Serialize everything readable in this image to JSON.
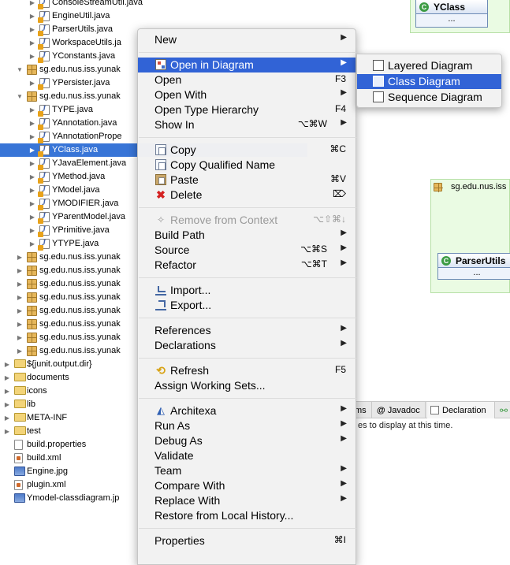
{
  "tree": {
    "rows": [
      {
        "label": "ConsoleStreamUtil.java",
        "kind": "java",
        "twisty": "right"
      },
      {
        "label": "EngineUtil.java",
        "kind": "java",
        "twisty": "right"
      },
      {
        "label": "ParserUtils.java",
        "kind": "java",
        "twisty": "right"
      },
      {
        "label": "WorkspaceUtils.ja",
        "kind": "java",
        "twisty": "right"
      },
      {
        "label": "YConstants.java",
        "kind": "java",
        "twisty": "right"
      },
      {
        "label": "sg.edu.nus.iss.yunak",
        "kind": "pkg",
        "twisty": "down"
      },
      {
        "label": "YPersister.java",
        "kind": "java",
        "twisty": "right"
      },
      {
        "label": "sg.edu.nus.iss.yunak",
        "kind": "pkg",
        "twisty": "down"
      },
      {
        "label": "TYPE.java",
        "kind": "java",
        "twisty": "right"
      },
      {
        "label": "YAnnotation.java",
        "kind": "java",
        "twisty": "right"
      },
      {
        "label": "YAnnotationPrope",
        "kind": "java",
        "twisty": "right"
      },
      {
        "label": "YClass.java",
        "kind": "java",
        "twisty": "right",
        "selected": true
      },
      {
        "label": "YJavaElement.java",
        "kind": "java",
        "twisty": "right"
      },
      {
        "label": "YMethod.java",
        "kind": "java",
        "twisty": "right"
      },
      {
        "label": "YModel.java",
        "kind": "java",
        "twisty": "right"
      },
      {
        "label": "YMODIFIER.java",
        "kind": "java",
        "twisty": "right"
      },
      {
        "label": "YParentModel.java",
        "kind": "java",
        "twisty": "right"
      },
      {
        "label": "YPrimitive.java",
        "kind": "java",
        "twisty": "right"
      },
      {
        "label": "YTYPE.java",
        "kind": "java",
        "twisty": "right"
      },
      {
        "label": "sg.edu.nus.iss.yunak",
        "kind": "pkg",
        "twisty": "right"
      },
      {
        "label": "sg.edu.nus.iss.yunak",
        "kind": "pkg",
        "twisty": "right"
      },
      {
        "label": "sg.edu.nus.iss.yunak",
        "kind": "pkg",
        "twisty": "right"
      },
      {
        "label": "sg.edu.nus.iss.yunak",
        "kind": "pkg",
        "twisty": "right"
      },
      {
        "label": "sg.edu.nus.iss.yunak",
        "kind": "pkg",
        "twisty": "right"
      },
      {
        "label": "sg.edu.nus.iss.yunak",
        "kind": "pkg",
        "twisty": "right"
      },
      {
        "label": "sg.edu.nus.iss.yunak",
        "kind": "pkg",
        "twisty": "right"
      },
      {
        "label": "sg.edu.nus.iss.yunak",
        "kind": "pkg",
        "twisty": "right"
      },
      {
        "label": "${junit.output.dir}",
        "kind": "folder",
        "twisty": "right"
      },
      {
        "label": "documents",
        "kind": "folder",
        "twisty": "right"
      },
      {
        "label": "icons",
        "kind": "folder",
        "twisty": "right"
      },
      {
        "label": "lib",
        "kind": "folder",
        "twisty": "right"
      },
      {
        "label": "META-INF",
        "kind": "folder",
        "twisty": "right"
      },
      {
        "label": "test",
        "kind": "folder",
        "twisty": "right"
      },
      {
        "label": "build.properties",
        "kind": "file",
        "twisty": "none"
      },
      {
        "label": "build.xml",
        "kind": "xml",
        "twisty": "none"
      },
      {
        "label": "Engine.jpg",
        "kind": "img",
        "twisty": "none"
      },
      {
        "label": "plugin.xml",
        "kind": "xml",
        "twisty": "none"
      },
      {
        "label": "Ymodel-classdiagram.jp",
        "kind": "img",
        "twisty": "none"
      }
    ]
  },
  "diagram": {
    "class_top": {
      "name": "YClass",
      "body": "..."
    },
    "package_label": "sg.edu.nus.iss",
    "class_bottom": {
      "name": "ParserUtils",
      "body": "..."
    }
  },
  "view_tabs": {
    "tabs": [
      {
        "label": "ms"
      },
      {
        "label": "Javadoc"
      },
      {
        "label": "Declaration"
      }
    ],
    "message": "es to display at this time."
  },
  "context_menu": {
    "items": [
      {
        "type": "item",
        "label": "New",
        "arrow": true
      },
      {
        "type": "sep"
      },
      {
        "type": "item",
        "label": "Open in Diagram",
        "arrow": true,
        "icon": "diagram-icon",
        "highlight": true
      },
      {
        "type": "item",
        "label": "Open",
        "shortcut": "F3"
      },
      {
        "type": "item",
        "label": "Open With",
        "arrow": true
      },
      {
        "type": "item",
        "label": "Open Type Hierarchy",
        "shortcut": "F4"
      },
      {
        "type": "item",
        "label": "Show In",
        "shortcut": "⌥⌘W",
        "arrow": true
      },
      {
        "type": "sep"
      },
      {
        "type": "item",
        "label": "Copy",
        "shortcut": "⌘C",
        "icon": "copy-icon"
      },
      {
        "type": "item",
        "label": "Copy Qualified Name",
        "icon": "copy-qualified-icon"
      },
      {
        "type": "item",
        "label": "Paste",
        "shortcut": "⌘V",
        "icon": "paste-icon"
      },
      {
        "type": "item",
        "label": "Delete",
        "shortcut": "⌦",
        "icon": "delete-icon"
      },
      {
        "type": "sep"
      },
      {
        "type": "item",
        "label": "Remove from Context",
        "shortcut": "⌥⇧⌘↓",
        "icon": "remove-context-icon",
        "disabled": true
      },
      {
        "type": "item",
        "label": "Build Path",
        "arrow": true
      },
      {
        "type": "item",
        "label": "Source",
        "shortcut": "⌥⌘S",
        "arrow": true
      },
      {
        "type": "item",
        "label": "Refactor",
        "shortcut": "⌥⌘T",
        "arrow": true
      },
      {
        "type": "sep"
      },
      {
        "type": "item",
        "label": "Import...",
        "icon": "import-icon"
      },
      {
        "type": "item",
        "label": "Export...",
        "icon": "export-icon"
      },
      {
        "type": "sep"
      },
      {
        "type": "item",
        "label": "References",
        "arrow": true
      },
      {
        "type": "item",
        "label": "Declarations",
        "arrow": true
      },
      {
        "type": "sep"
      },
      {
        "type": "item",
        "label": "Refresh",
        "shortcut": "F5",
        "icon": "refresh-icon"
      },
      {
        "type": "item",
        "label": "Assign Working Sets..."
      },
      {
        "type": "sep"
      },
      {
        "type": "item",
        "label": "Architexa",
        "arrow": true,
        "icon": "architexa-icon"
      },
      {
        "type": "item",
        "label": "Run As",
        "arrow": true
      },
      {
        "type": "item",
        "label": "Debug As",
        "arrow": true
      },
      {
        "type": "item",
        "label": "Validate"
      },
      {
        "type": "item",
        "label": "Team",
        "arrow": true
      },
      {
        "type": "item",
        "label": "Compare With",
        "arrow": true
      },
      {
        "type": "item",
        "label": "Replace With",
        "arrow": true
      },
      {
        "type": "item",
        "label": "Restore from Local History..."
      },
      {
        "type": "sep"
      },
      {
        "type": "item",
        "label": "Properties",
        "shortcut": "⌘I"
      }
    ]
  },
  "submenu": {
    "items": [
      {
        "label": "Layered Diagram",
        "icon": "layered-diagram-icon"
      },
      {
        "label": "Class Diagram",
        "icon": "class-diagram-icon",
        "highlight": true
      },
      {
        "label": "Sequence Diagram",
        "icon": "sequence-diagram-icon"
      }
    ]
  },
  "colors": {
    "selection": "#3163d6",
    "tree_selection": "#3875d7",
    "package_fill": "#eafbe3"
  }
}
